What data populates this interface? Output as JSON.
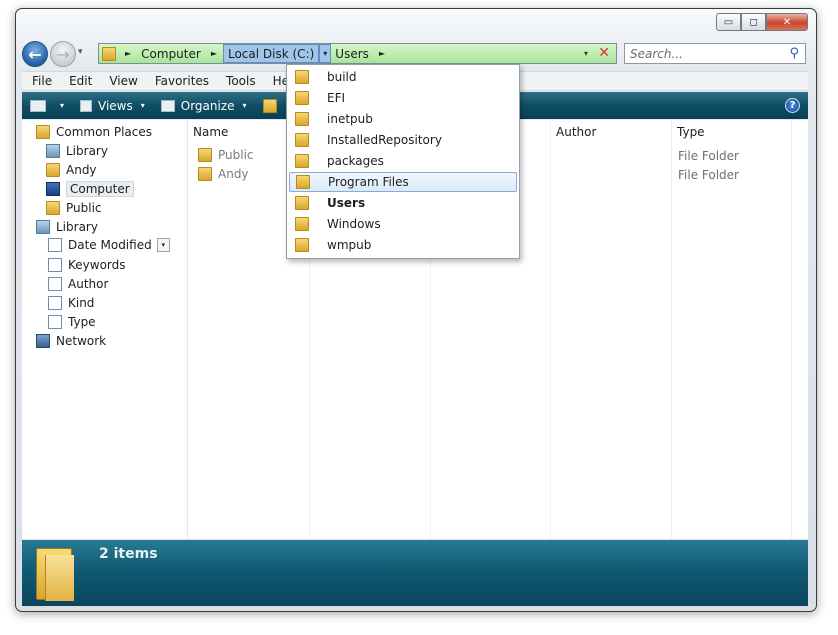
{
  "window": {
    "caption_buttons": {
      "minimize": "▭",
      "maximize": "◻",
      "close": "✕"
    }
  },
  "nav": {
    "back_glyph": "←",
    "forward_glyph": "→",
    "history_glyph": "▾"
  },
  "address": {
    "crumbs": [
      "Computer",
      "Local Disk (C:)",
      "Users"
    ],
    "separator": "►",
    "dropdown_glyph": "▾",
    "clear_glyph": "✕"
  },
  "search": {
    "placeholder": "Search...",
    "icon": "search-icon"
  },
  "menubar": [
    "File",
    "Edit",
    "View",
    "Favorites",
    "Tools",
    "Help"
  ],
  "commandbar": {
    "views": "Views",
    "organize": "Organize",
    "arrow": "▾",
    "help": "?"
  },
  "navpane": {
    "items": [
      {
        "label": "Common Places",
        "icon": "folder-icon"
      },
      {
        "label": "Library",
        "icon": "library-icon"
      },
      {
        "label": "Andy",
        "icon": "folder-icon"
      },
      {
        "label": "Computer",
        "icon": "computer-icon"
      },
      {
        "label": "Public",
        "icon": "folder-icon"
      },
      {
        "label": "Library",
        "icon": "library-icon"
      },
      {
        "label": "Date Modified",
        "icon": "document-icon"
      },
      {
        "label": "Keywords",
        "icon": "document-icon"
      },
      {
        "label": "Author",
        "icon": "document-icon"
      },
      {
        "label": "Kind",
        "icon": "document-icon"
      },
      {
        "label": "Type",
        "icon": "document-icon"
      },
      {
        "label": "Network",
        "icon": "network-icon"
      }
    ],
    "dropdown_glyph": "▾"
  },
  "files": {
    "columns": {
      "name": "Name",
      "author": "Author",
      "type": "Type"
    },
    "rows": [
      {
        "name": "Public",
        "type": "File Folder"
      },
      {
        "name": "Andy",
        "type": "File Folder"
      }
    ]
  },
  "details": {
    "count": "2 items"
  },
  "dropdown": {
    "items": [
      {
        "label": "build"
      },
      {
        "label": "EFI"
      },
      {
        "label": "inetpub"
      },
      {
        "label": "InstalledRepository"
      },
      {
        "label": "packages"
      },
      {
        "label": "Program Files",
        "highlighted": true
      },
      {
        "label": "Users",
        "current": true
      },
      {
        "label": "Windows"
      },
      {
        "label": "wmpub"
      }
    ]
  }
}
